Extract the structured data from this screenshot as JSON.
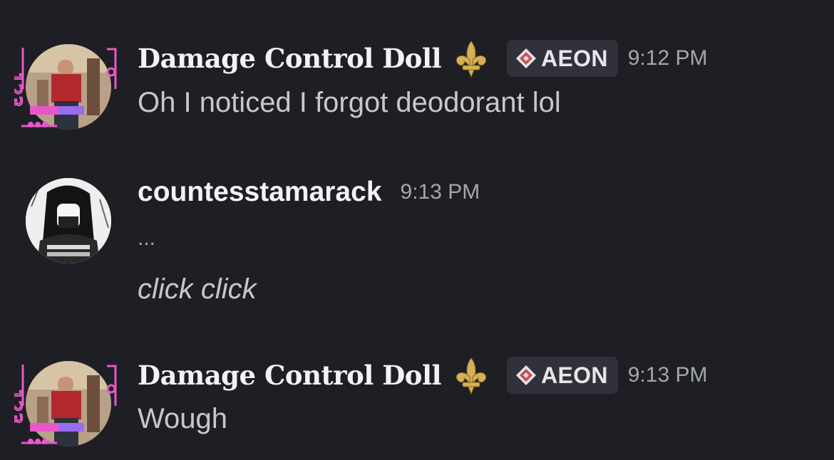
{
  "messages": [
    {
      "author": "Damage Control Doll",
      "tag": "AEON",
      "time": "9:12 PM",
      "lines": [
        "Oh I noticed I forgot deodorant lol"
      ]
    },
    {
      "author": "countesstamarack",
      "time": "9:13 PM",
      "lines": [
        "...",
        "click click"
      ]
    },
    {
      "author": "Damage Control Doll",
      "tag": "AEON",
      "time": "9:13 PM",
      "lines": [
        "Wough"
      ]
    }
  ],
  "icons": {
    "badge": "fleur-de-lis-icon",
    "tag": "diamond-icon"
  },
  "colors": {
    "background": "#1e1f24",
    "username": "#f2f3f5",
    "timestamp": "#a4a6ad",
    "tag_background": "#30313a",
    "avatar_frame": "#e857c8"
  }
}
